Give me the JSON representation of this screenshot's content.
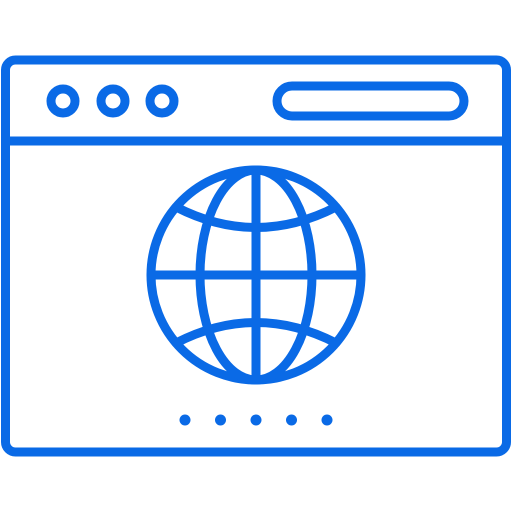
{
  "icon": {
    "name": "browser-window-globe-icon",
    "accent_color": "#0a6ae6",
    "background_color": "#ffffff",
    "window_control_icons": [
      "circle-icon",
      "circle-icon",
      "circle-icon"
    ],
    "address_bar_icon": "address-bar-icon",
    "globe_icon": "globe-icon",
    "pagination_dot_count": 5
  }
}
